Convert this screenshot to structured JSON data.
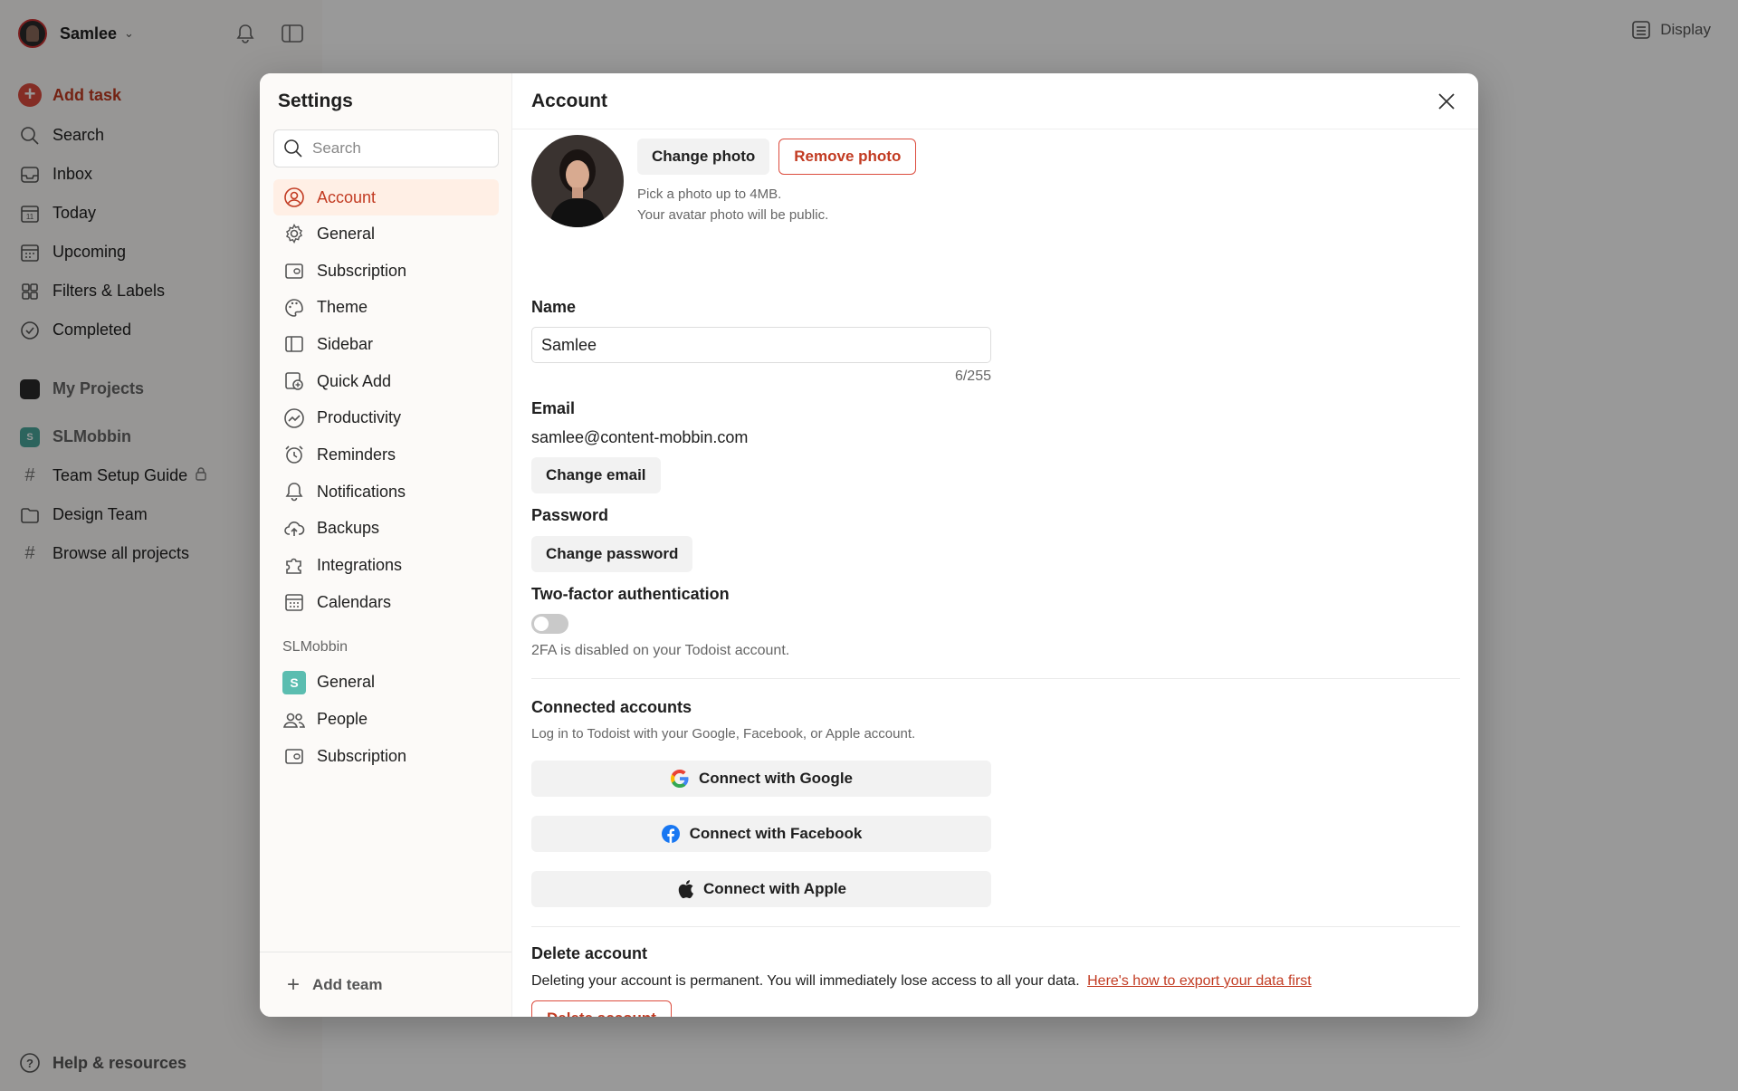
{
  "app": {
    "user_name": "Samlee",
    "add_task": "Add task",
    "nav": [
      {
        "label": "Search",
        "icon": "search-icon"
      },
      {
        "label": "Inbox",
        "icon": "inbox-icon"
      },
      {
        "label": "Today",
        "icon": "calendar-today-icon"
      },
      {
        "label": "Upcoming",
        "icon": "calendar-upcoming-icon"
      },
      {
        "label": "Filters & Labels",
        "icon": "filters-icon"
      },
      {
        "label": "Completed",
        "icon": "check-circle-icon"
      }
    ],
    "my_projects": "My Projects",
    "workspace": "SLMobbin",
    "workspace_initial": "S",
    "projects": [
      "Team Setup Guide",
      "Design Team",
      "Browse all projects"
    ],
    "help": "Help & resources",
    "display": "Display",
    "accent_color": "#dc4c3e"
  },
  "settings": {
    "title": "Settings",
    "search_placeholder": "Search",
    "nav": [
      {
        "label": "Account",
        "icon": "user-circle-icon",
        "active": true
      },
      {
        "label": "General",
        "icon": "gear-icon"
      },
      {
        "label": "Subscription",
        "icon": "wallet-icon"
      },
      {
        "label": "Theme",
        "icon": "palette-icon"
      },
      {
        "label": "Sidebar",
        "icon": "sidebar-icon"
      },
      {
        "label": "Quick Add",
        "icon": "quick-add-icon"
      },
      {
        "label": "Productivity",
        "icon": "trend-icon"
      },
      {
        "label": "Reminders",
        "icon": "alarm-icon"
      },
      {
        "label": "Notifications",
        "icon": "bell-icon"
      },
      {
        "label": "Backups",
        "icon": "cloud-upload-icon"
      },
      {
        "label": "Integrations",
        "icon": "puzzle-icon"
      },
      {
        "label": "Calendars",
        "icon": "calendar-icon"
      }
    ],
    "team_label": "SLMobbin",
    "team_initial": "S",
    "team_nav": [
      {
        "label": "General",
        "icon": "workspace-icon"
      },
      {
        "label": "People",
        "icon": "people-icon"
      },
      {
        "label": "Subscription",
        "icon": "wallet-icon"
      }
    ],
    "add_team": "Add team"
  },
  "account": {
    "title": "Account",
    "change_photo": "Change photo",
    "remove_photo": "Remove photo",
    "photo_note_1": "Pick a photo up to 4MB.",
    "photo_note_2": "Your avatar photo will be public.",
    "name_label": "Name",
    "name_value": "Samlee",
    "name_count": "6/255",
    "email_label": "Email",
    "email_value": "samlee@content-mobbin.com",
    "change_email": "Change email",
    "password_label": "Password",
    "change_password": "Change password",
    "twofa_label": "Two-factor authentication",
    "twofa_enabled": false,
    "twofa_note": "2FA is disabled on your Todoist account.",
    "connected_label": "Connected accounts",
    "connected_note": "Log in to Todoist with your Google, Facebook, or Apple account.",
    "connect_google": "Connect with Google",
    "connect_facebook": "Connect with Facebook",
    "connect_apple": "Connect with Apple",
    "delete_label": "Delete account",
    "delete_note": "Deleting your account is permanent. You will immediately lose access to all your data.",
    "delete_link": "Here's how to export your data first",
    "delete_button": "Delete account"
  }
}
